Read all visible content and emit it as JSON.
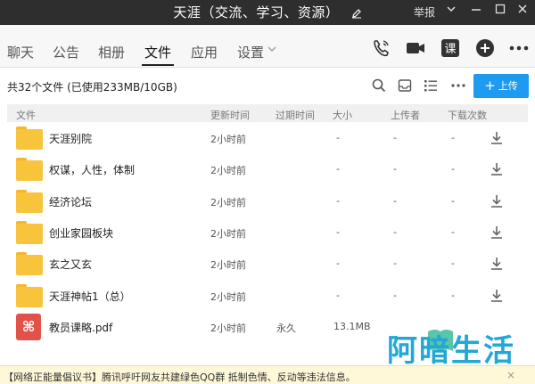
{
  "window": {
    "title": "天涯（交流、学习、资源）",
    "report_label": "举报"
  },
  "nav": {
    "tabs": [
      "聊天",
      "公告",
      "相册",
      "文件",
      "应用",
      "设置"
    ],
    "active_tab": "文件"
  },
  "toolbar": {
    "summary": "共32个文件 (已使用233MB/10GB)",
    "upload_label": "上传"
  },
  "table": {
    "columns": [
      "文件",
      "更新时间",
      "过期时间",
      "大小",
      "上传者",
      "下载次数"
    ],
    "rows": [
      {
        "name": "天涯别院",
        "type": "folder",
        "updated": "2小时前",
        "expire": "",
        "size": "-",
        "uploader": "-",
        "downloads": "-"
      },
      {
        "name": "权谋，人性，体制",
        "type": "folder",
        "updated": "2小时前",
        "expire": "",
        "size": "-",
        "uploader": "-",
        "downloads": "-"
      },
      {
        "name": "经济论坛",
        "type": "folder",
        "updated": "2小时前",
        "expire": "",
        "size": "-",
        "uploader": "-",
        "downloads": "-"
      },
      {
        "name": "创业家园板块",
        "type": "folder",
        "updated": "2小时前",
        "expire": "",
        "size": "-",
        "uploader": "-",
        "downloads": "-"
      },
      {
        "name": "玄之又玄",
        "type": "folder",
        "updated": "2小时前",
        "expire": "",
        "size": "-",
        "uploader": "-",
        "downloads": "-"
      },
      {
        "name": "天涯神帖1（总）",
        "type": "folder",
        "updated": "2小时前",
        "expire": "",
        "size": "-",
        "uploader": "-",
        "downloads": "-"
      },
      {
        "name": "教员课略.pdf",
        "type": "pdf",
        "updated": "2小时前",
        "expire": "永久",
        "size": "13.1MB",
        "uploader": "",
        "downloads": ""
      }
    ]
  },
  "watermark": {
    "text": "阿暗生活"
  },
  "footer": {
    "text": "【网络正能量倡议书】腾讯呼吁网友共建绿色QQ群 抵制色情、反动等违法信息。",
    "close": "×"
  },
  "colors": {
    "titlebar": "#2e2e2e",
    "accent": "#1e9bf0",
    "folder": "#f8c43c",
    "pdf": "#e25249"
  }
}
